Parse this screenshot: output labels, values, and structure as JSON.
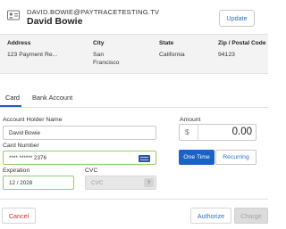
{
  "customer": {
    "email": "DAVID.BOWIE@PAYTRACETESTING.TV",
    "name": "David  Bowie",
    "update_label": "Update"
  },
  "address": {
    "headers": {
      "address": "Address",
      "city": "City",
      "state": "State",
      "zip": "Zip / Postal Code"
    },
    "values": {
      "address": "123 Payment Re...",
      "city_line1": "San",
      "city_line2": "Francisco",
      "state": "California",
      "zip": "94123"
    }
  },
  "tabs": {
    "card": "Card",
    "bank": "Bank Account"
  },
  "form": {
    "holder_label": "Account Holder Name",
    "holder_value": "David Bowie",
    "card_label": "Card Number",
    "card_value": "**** ****** 2376",
    "expiration_label": "Expiration",
    "expiration_value": "12 / 2028",
    "cvc_label": "CVC",
    "cvc_placeholder": "CVC",
    "cvc_help": "?"
  },
  "amount": {
    "label": "Amount",
    "currency_symbol": "$",
    "value": "0.00"
  },
  "frequency": {
    "one_time": "One Time",
    "recurring": "Recurring"
  },
  "actions": {
    "cancel": "Cancel",
    "authorize": "Authorize",
    "charge": "Charge"
  },
  "colors": {
    "accent": "#1a62c6",
    "link": "#2a6fc9",
    "cancel": "#c8312b",
    "valid_border": "#8fcf6a"
  }
}
